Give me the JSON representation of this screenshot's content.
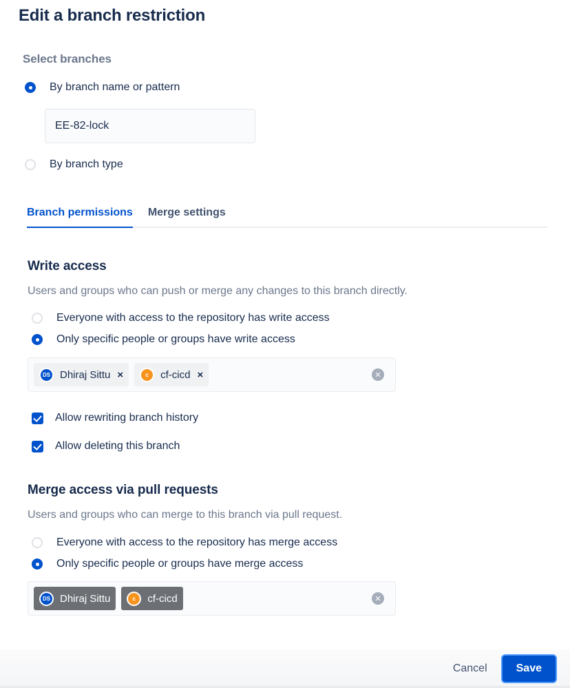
{
  "dialog": {
    "title": "Edit a branch restriction"
  },
  "select_branches": {
    "label": "Select branches",
    "options": [
      {
        "label": "By branch name or pattern",
        "selected": true
      },
      {
        "label": "By branch type",
        "selected": false
      }
    ],
    "pattern_input": {
      "value": "EE-82-lock",
      "placeholder": ""
    }
  },
  "tabs": [
    {
      "label": "Branch permissions",
      "active": true
    },
    {
      "label": "Merge settings",
      "active": false
    }
  ],
  "write_access": {
    "heading": "Write access",
    "description": "Users and groups who can push or merge any changes to this branch directly.",
    "options": [
      {
        "label": "Everyone with access to the repository has write access",
        "selected": false
      },
      {
        "label": "Only specific people or groups have write access",
        "selected": true
      }
    ],
    "chips": [
      {
        "initials": "DS",
        "avatar_color": "#0052cc",
        "label": "Dhiraj Sittu",
        "style": "light",
        "removable": true
      },
      {
        "initials": "c",
        "avatar_color": "#f7941e",
        "label": "cf-cicd",
        "style": "light",
        "removable": true
      }
    ],
    "remove_icon": "×",
    "clear_all_icon": "✕",
    "checkboxes": [
      {
        "label": "Allow rewriting branch history",
        "checked": true
      },
      {
        "label": "Allow deleting this branch",
        "checked": true
      }
    ]
  },
  "merge_access": {
    "heading": "Merge access via pull requests",
    "description": "Users and groups who can merge to this branch via pull request.",
    "options": [
      {
        "label": "Everyone with access to the repository has merge access",
        "selected": false
      },
      {
        "label": "Only specific people or groups have merge access",
        "selected": true
      }
    ],
    "chips": [
      {
        "initials": "DS",
        "avatar_color": "#0052cc",
        "label": "Dhiraj Sittu",
        "style": "dark",
        "removable": false
      },
      {
        "initials": "c",
        "avatar_color": "#f7941e",
        "label": "cf-cicd",
        "style": "dark",
        "removable": false
      }
    ],
    "clear_all_icon": "✕"
  },
  "footer": {
    "cancel_label": "Cancel",
    "save_label": "Save"
  },
  "colors": {
    "accent": "#0052cc",
    "text": "#172b4d",
    "muted": "#6b778c",
    "avatar_blue": "#0052cc",
    "avatar_orange": "#f7941e",
    "chip_dark": "#6c6f74",
    "focus_ring": "#4c9aff"
  }
}
